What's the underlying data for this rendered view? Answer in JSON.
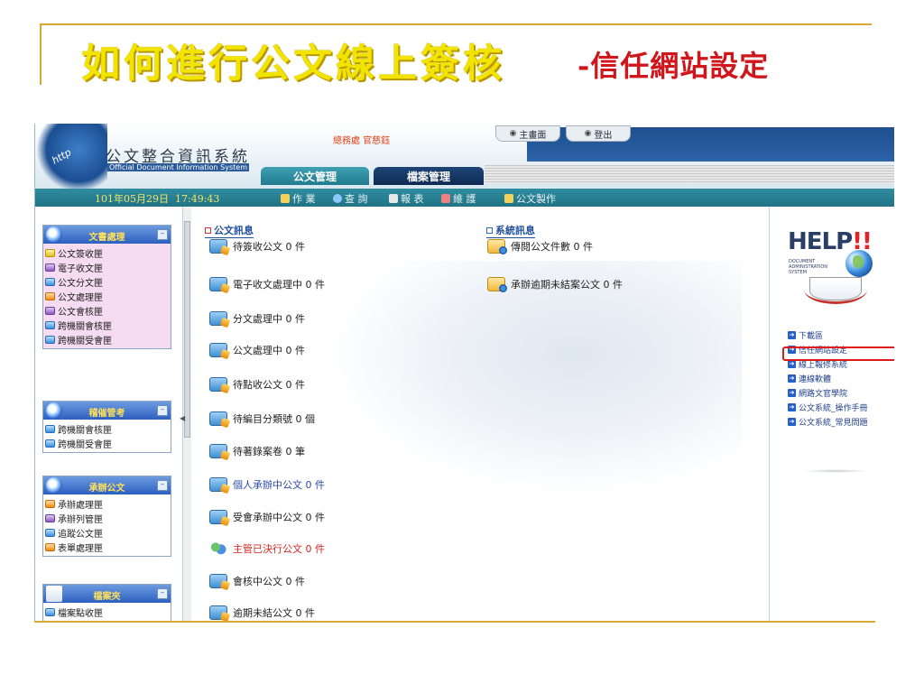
{
  "slide": {
    "title": "如何進行公文線上簽核",
    "subtitle": "-信任網站設定"
  },
  "header": {
    "system_title": "公文整合資訊系統",
    "system_subtitle": "Official Document Information System",
    "user_name": "總務處 官慈鈺",
    "home_label": "主畫面",
    "logout_label": "登出",
    "tabs": [
      "公文管理",
      "檔案管理"
    ],
    "date": "101年05月29日",
    "time": "17:49:43",
    "menu": [
      "作 業",
      "查 詢",
      "報 表",
      "維 護",
      "公文製作"
    ]
  },
  "sidebar": {
    "panels": [
      {
        "title": "文書處理",
        "items": [
          {
            "label": "公文簽收匣",
            "icon": "yellow"
          },
          {
            "label": "電子收文匣",
            "icon": "purple"
          },
          {
            "label": "公文分文匣",
            "icon": "blue"
          },
          {
            "label": "公文處理匣",
            "icon": "orange"
          },
          {
            "label": "公文會核匣",
            "icon": "purple"
          },
          {
            "label": "跨機關會核匣",
            "icon": "blue"
          },
          {
            "label": "跨機關受會匣",
            "icon": "blue"
          }
        ]
      },
      {
        "title": "稽催管考",
        "items": [
          {
            "label": "跨機關會核匣",
            "icon": "blue"
          },
          {
            "label": "跨機關受會匣",
            "icon": "blue"
          }
        ]
      },
      {
        "title": "承辦公文",
        "items": [
          {
            "label": "承辦處理匣",
            "icon": "orange"
          },
          {
            "label": "承辦列管匣",
            "icon": "purple"
          },
          {
            "label": "追蹤公文匣",
            "icon": "blue"
          },
          {
            "label": "表單處理匣",
            "icon": "orange"
          }
        ]
      },
      {
        "title": "檔案夾",
        "items": [
          {
            "label": "檔案點收匣",
            "icon": "blue"
          }
        ]
      }
    ]
  },
  "center": {
    "doc_info_title": "公文訊息",
    "sys_info_title": "系統訊息",
    "doc_messages": [
      {
        "text": "待簽收公文 0 件",
        "style": "normal",
        "icon": "tray"
      },
      {
        "text": "電子收文處理中 0 件",
        "style": "normal",
        "icon": "tray"
      },
      {
        "text": "分文處理中 0 件",
        "style": "normal",
        "icon": "tray"
      },
      {
        "text": "公文處理中 0 件",
        "style": "normal",
        "icon": "tray"
      },
      {
        "text": "待點收公文 0 件",
        "style": "normal",
        "icon": "tray"
      },
      {
        "text": "待編目分類號 0 個",
        "style": "normal",
        "icon": "tray"
      },
      {
        "text": "待著錄案卷 0 筆",
        "style": "normal",
        "icon": "tray"
      },
      {
        "text": "個人承辦中公文 0 件",
        "style": "blue",
        "icon": "tray"
      },
      {
        "text": "受會承辦中公文 0 件",
        "style": "normal",
        "icon": "tray"
      },
      {
        "text": "主管已決行公文 0 件",
        "style": "red",
        "icon": "people"
      },
      {
        "text": "會核中公文 0 件",
        "style": "normal",
        "icon": "tray"
      },
      {
        "text": "逾期未結公文 0 件",
        "style": "normal",
        "icon": "tray"
      }
    ],
    "sys_messages": [
      {
        "text": "傳閱公文件數 0 件",
        "icon": "folder"
      },
      {
        "text": "承辦逾期未結案公文 0 件",
        "icon": "folder"
      }
    ]
  },
  "help": {
    "title": "HELP",
    "title_marks": "!!",
    "subtitle": "DOCUMENT ADMINISTRATION SYSTEM",
    "links": [
      "下載區",
      "信任網站設定",
      "線上報修系統",
      "連線軟體",
      "網路文官學院",
      "公文系統_操作手冊",
      "公文系統_常見問題"
    ]
  },
  "colors": {
    "title_yellow": "#f1e400",
    "subtitle_red": "#d1161b",
    "rule_gold": "#d9a934",
    "highlight_red": "#e01a1a",
    "datebar_teal": "#207385"
  }
}
